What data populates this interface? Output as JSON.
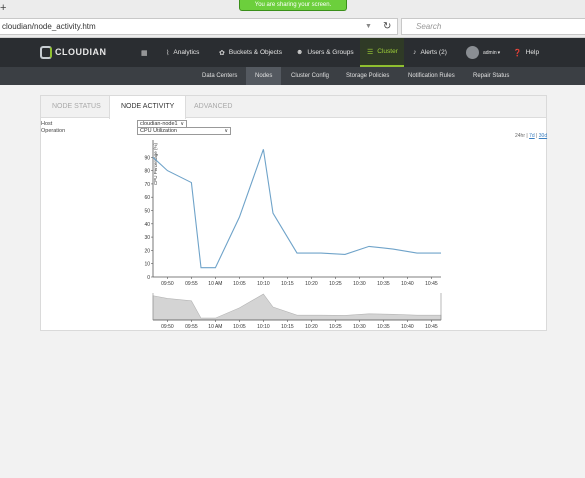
{
  "browser": {
    "sharing_banner": "You are sharing your screen.",
    "url": "cloudian/node_activity.htm",
    "search_placeholder": "Search"
  },
  "nav": {
    "logo": "CLOUDIAN",
    "items": [
      {
        "label": "",
        "icon": "grid-icon"
      },
      {
        "label": "Analytics",
        "icon": "chart-icon"
      },
      {
        "label": "Buckets & Objects",
        "icon": "gear-icon"
      },
      {
        "label": "Users & Groups",
        "icon": "users-icon"
      },
      {
        "label": "Cluster",
        "icon": "list-icon",
        "active": true
      },
      {
        "label": "Alerts (2)",
        "icon": "bell-icon"
      },
      {
        "label": "admin",
        "icon": "avatar-icon"
      },
      {
        "label": "Help",
        "icon": "help-icon"
      }
    ]
  },
  "subnav": {
    "items": [
      "Data Centers",
      "Nodes",
      "Cluster Config",
      "Storage Policies",
      "Notification Rules",
      "Repair Status"
    ],
    "active": "Nodes"
  },
  "tabs": {
    "items": [
      "NODE STATUS",
      "NODE ACTIVITY",
      "ADVANCED"
    ],
    "active": "NODE ACTIVITY"
  },
  "form": {
    "host_label": "Host",
    "host_value": "cloudian-node1",
    "operation_label": "Operation",
    "operation_value": "CPU Utilization"
  },
  "range": {
    "options": [
      "24hr",
      "7d",
      "30d"
    ],
    "separator": "|"
  },
  "colors": {
    "accent": "#8fbf2f",
    "navbar": "#2a2d31",
    "line": "#6fa3c9",
    "area": "#d4d4d4"
  },
  "chart_data": [
    {
      "type": "line",
      "ylabel": "CPU Percentage (%)",
      "ylim": [
        0,
        100
      ],
      "yticks": [
        0,
        10,
        20,
        30,
        40,
        50,
        60,
        70,
        80,
        90
      ],
      "xticks": [
        "09:50",
        "09:55",
        "10 AM",
        "10:05",
        "10:10",
        "10:15",
        "10:20",
        "10:25",
        "10:30",
        "10:35",
        "10:40",
        "10:45"
      ],
      "x": [
        "09:47",
        "09:50",
        "09:55",
        "09:57",
        "10:00",
        "10:05",
        "10:10",
        "10:12",
        "10:17",
        "10:22",
        "10:27",
        "10:32",
        "10:37",
        "10:42",
        "10:47"
      ],
      "values": [
        90,
        80,
        71,
        7,
        7,
        45,
        96,
        48,
        18,
        18,
        17,
        23,
        21,
        18,
        18
      ]
    },
    {
      "type": "area",
      "xticks": [
        "09:50",
        "09:55",
        "10 AM",
        "10:05",
        "10:10",
        "10:15",
        "10:20",
        "10:25",
        "10:30",
        "10:35",
        "10:40",
        "10:45"
      ],
      "x": [
        "09:47",
        "09:50",
        "09:55",
        "09:57",
        "10:00",
        "10:05",
        "10:10",
        "10:12",
        "10:17",
        "10:22",
        "10:27",
        "10:32",
        "10:37",
        "10:42",
        "10:47"
      ],
      "values": [
        90,
        80,
        71,
        7,
        7,
        45,
        96,
        48,
        18,
        18,
        17,
        23,
        21,
        18,
        18
      ]
    }
  ]
}
